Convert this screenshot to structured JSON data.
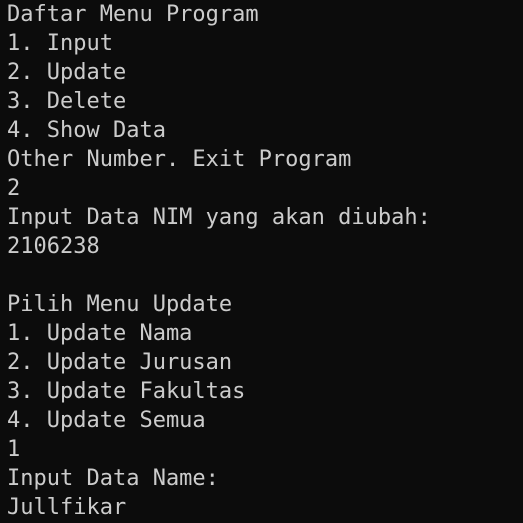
{
  "terminal": {
    "lines": [
      "Daftar Menu Program",
      "1. Input",
      "2. Update",
      "3. Delete",
      "4. Show Data",
      "Other Number. Exit Program",
      "2",
      "Input Data NIM yang akan diubah:",
      "2106238",
      "",
      "Pilih Menu Update",
      "1. Update Nama",
      "2. Update Jurusan",
      "3. Update Fakultas",
      "4. Update Semua",
      "1",
      "Input Data Name:",
      "Jullfikar"
    ]
  }
}
